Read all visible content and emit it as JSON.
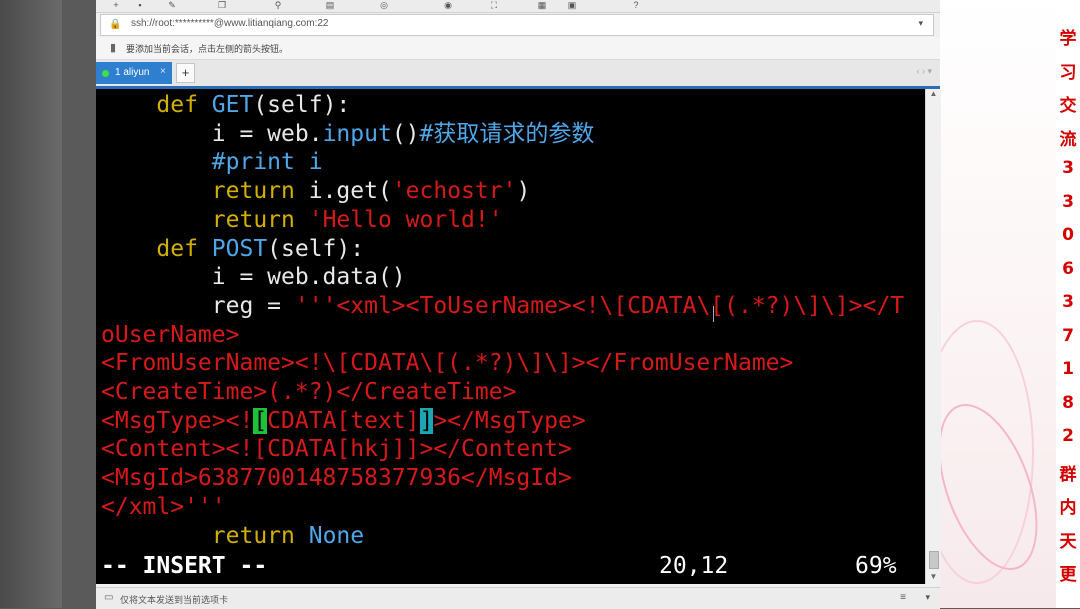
{
  "address": {
    "url": "ssh://root:**********@www.litianqiang.com:22"
  },
  "hint": {
    "text": "要添加当前会话，点击左侧的箭头按钮。"
  },
  "tabs": [
    {
      "label": "1 aliyun",
      "close": "×"
    }
  ],
  "tab_add": "+",
  "tab_nav": "‹ › ▾",
  "code": [
    [
      {
        "t": "    ",
        "c": ""
      },
      {
        "t": "def ",
        "c": "kw"
      },
      {
        "t": "GET",
        "c": "fn"
      },
      {
        "t": "(self):",
        "c": ""
      }
    ],
    [
      {
        "t": "        i = web.",
        "c": ""
      },
      {
        "t": "input",
        "c": "fn"
      },
      {
        "t": "()",
        "c": ""
      },
      {
        "t": "#获取请求的参数",
        "c": "cm"
      }
    ],
    [
      {
        "t": "        ",
        "c": ""
      },
      {
        "t": "#print i",
        "c": "cm"
      }
    ],
    [
      {
        "t": "        ",
        "c": ""
      },
      {
        "t": "return ",
        "c": "kw"
      },
      {
        "t": "i.get(",
        "c": ""
      },
      {
        "t": "'echostr'",
        "c": "st"
      },
      {
        "t": ")",
        "c": ""
      }
    ],
    [
      {
        "t": "        ",
        "c": ""
      },
      {
        "t": "return ",
        "c": "kw"
      },
      {
        "t": "'Hello world!'",
        "c": "st"
      }
    ],
    [
      {
        "t": "    ",
        "c": ""
      },
      {
        "t": "def ",
        "c": "kw"
      },
      {
        "t": "POST",
        "c": "fn"
      },
      {
        "t": "(self):",
        "c": ""
      }
    ],
    [
      {
        "t": "        i = web.data()",
        "c": ""
      }
    ],
    [
      {
        "t": "        reg = ",
        "c": ""
      },
      {
        "t": "'''<xml><ToUserName><!\\[CDATA\\[(.*?)\\]\\]></T",
        "c": "st"
      }
    ],
    [
      {
        "t": "oUserName>",
        "c": "st"
      }
    ],
    [
      {
        "t": "<FromUserName><!\\[CDATA\\[(.*?)\\]\\]></FromUserName>",
        "c": "st"
      }
    ],
    [
      {
        "t": "<CreateTime>(.*?)</CreateTime>",
        "c": "st"
      }
    ],
    [
      {
        "t": "<MsgType><!",
        "c": "st"
      },
      {
        "t": "[",
        "c": "cur-g"
      },
      {
        "t": "CDATA[text]",
        "c": "st"
      },
      {
        "t": "]",
        "c": "cur-c"
      },
      {
        "t": "></MsgType>",
        "c": "st"
      }
    ],
    [
      {
        "t": "<Content><![CDATA[hkj]]></Content>",
        "c": "st"
      }
    ],
    [
      {
        "t": "<MsgId>6387700148758377936</MsgId>",
        "c": "st"
      }
    ],
    [
      {
        "t": "</xml>'''",
        "c": "st"
      }
    ],
    [
      {
        "t": "        ",
        "c": ""
      },
      {
        "t": "return ",
        "c": "kw"
      },
      {
        "t": "None",
        "c": "fn"
      }
    ]
  ],
  "status": {
    "mode": "-- INSERT --",
    "position": "20,12",
    "percent": "69%"
  },
  "bottom": {
    "text": "仅将文本发送到当前选项卡"
  },
  "sidebar_chars": [
    "学",
    "习",
    "交",
    "流",
    "3",
    "3",
    "0",
    "6",
    "3",
    "7",
    "1",
    "8",
    "2",
    "群",
    "内",
    "天",
    "更"
  ],
  "colors": {
    "keyword": "#d2b000",
    "function": "#4fa7e8",
    "string": "#d61a1a",
    "tab_active": "#2f7fd0",
    "sidebar_text": "#d40000"
  }
}
